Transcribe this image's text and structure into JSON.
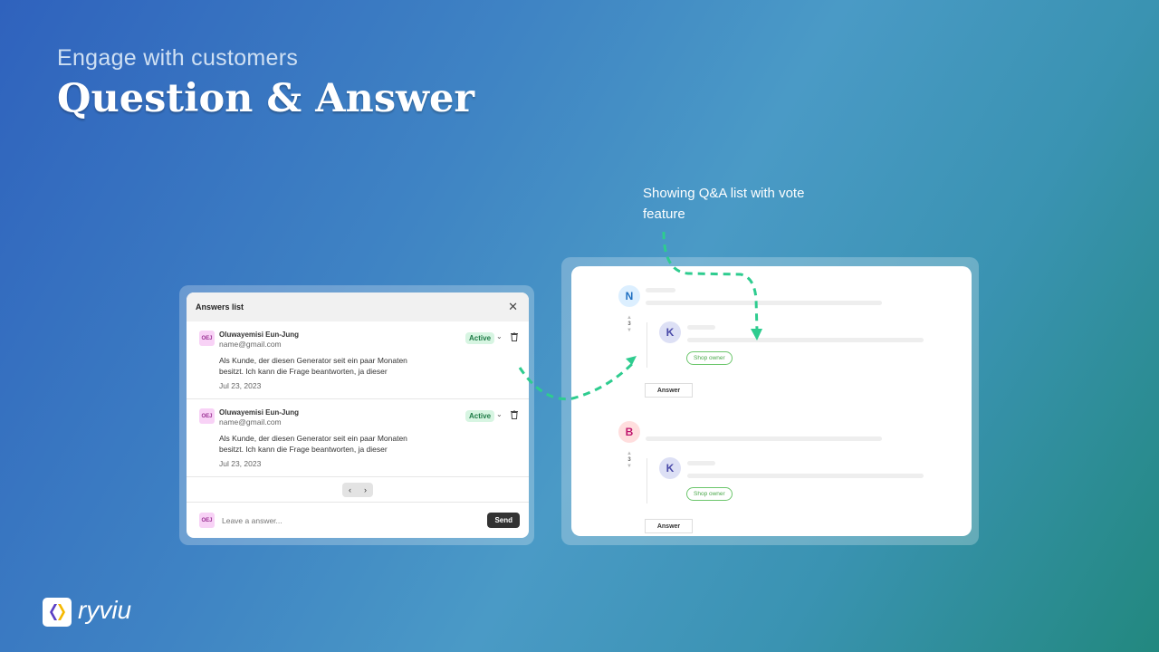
{
  "hero": {
    "subtitle": "Engage with customers",
    "title": "Question & Answer"
  },
  "annotation": "Showing Q&A list with vote feature",
  "answers_panel": {
    "title": "Answers list",
    "items": [
      {
        "initials": "OEJ",
        "name": "Oluwayemisi Eun-Jung",
        "email": "name@gmail.com",
        "status": "Active",
        "text": "Als Kunde, der diesen Generator seit ein paar Monaten besitzt. Ich kann die Frage beantworten, ja dieser",
        "date": "Jul 23, 2023"
      },
      {
        "initials": "OEJ",
        "name": "Oluwayemisi Eun-Jung",
        "email": "name@gmail.com",
        "status": "Active",
        "text": "Als Kunde, der diesen Generator seit ein paar Monaten besitzt. Ich kann die Frage beantworten, ja dieser",
        "date": "Jul 23, 2023"
      }
    ],
    "pager": {
      "prev": "‹",
      "next": "›"
    },
    "footer": {
      "initials": "OEJ",
      "placeholder": "Leave a answer...",
      "send": "Send"
    }
  },
  "qa_preview": {
    "questions": [
      {
        "initial": "N",
        "votes": "3",
        "answer_initial": "K",
        "badge": "Shop owner",
        "answer_button": "Answer"
      },
      {
        "initial": "B",
        "votes": "3",
        "answer_initial": "K",
        "badge": "Shop owner",
        "answer_button": "Answer"
      }
    ]
  },
  "brand": {
    "name": "ryviu"
  },
  "colors": {
    "accent": "#2ecc8f",
    "active_bg": "#d7f5e2",
    "avatar_bg": "#f8d2f6"
  }
}
